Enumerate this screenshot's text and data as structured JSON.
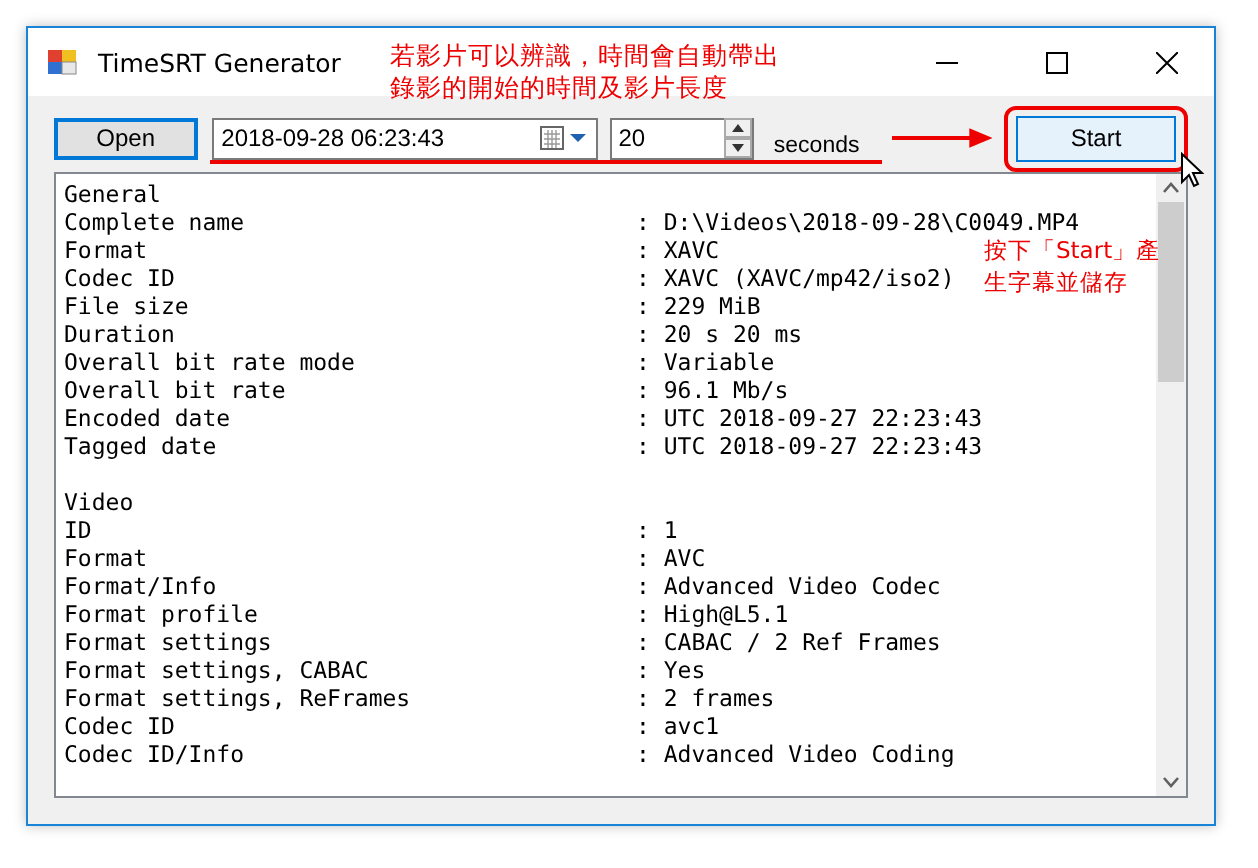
{
  "window": {
    "title": "TimeSRT Generator"
  },
  "toolbar": {
    "open_button": "Open",
    "date_time": "2018-09-28 06:23:43",
    "seconds_value": "20",
    "seconds_label": "seconds",
    "start_button": "Start"
  },
  "sections": [
    {
      "title": "General",
      "rows": [
        {
          "label": "Complete name",
          "value": ": D:\\Videos\\2018-09-28\\C0049.MP4"
        },
        {
          "label": "Format",
          "value": ": XAVC"
        },
        {
          "label": "Codec ID",
          "value": ": XAVC (XAVC/mp42/iso2)"
        },
        {
          "label": "File size",
          "value": ": 229 MiB"
        },
        {
          "label": "Duration",
          "value": ": 20 s 20 ms"
        },
        {
          "label": "Overall bit rate mode",
          "value": ": Variable"
        },
        {
          "label": "Overall bit rate",
          "value": ": 96.1 Mb/s"
        },
        {
          "label": "Encoded date",
          "value": ": UTC 2018-09-27 22:23:43"
        },
        {
          "label": "Tagged date",
          "value": ": UTC 2018-09-27 22:23:43"
        }
      ]
    },
    {
      "title": "Video",
      "rows": [
        {
          "label": "ID",
          "value": ": 1"
        },
        {
          "label": "Format",
          "value": ": AVC"
        },
        {
          "label": "Format/Info",
          "value": ": Advanced Video Codec"
        },
        {
          "label": "Format profile",
          "value": ": High@L5.1"
        },
        {
          "label": "Format settings",
          "value": ": CABAC / 2 Ref Frames"
        },
        {
          "label": "Format settings, CABAC",
          "value": ": Yes"
        },
        {
          "label": "Format settings, ReFrames",
          "value": ": 2 frames"
        },
        {
          "label": "Codec ID",
          "value": ": avc1"
        },
        {
          "label": "Codec ID/Info",
          "value": ": Advanced Video Coding"
        }
      ]
    }
  ],
  "annotations": {
    "top_note": [
      "若影片可以辨識，時間會自動帶出",
      "錄影的開始的時間及影片長度"
    ],
    "start_note": [
      "按下「Start」產",
      "生字幕並儲存"
    ]
  }
}
